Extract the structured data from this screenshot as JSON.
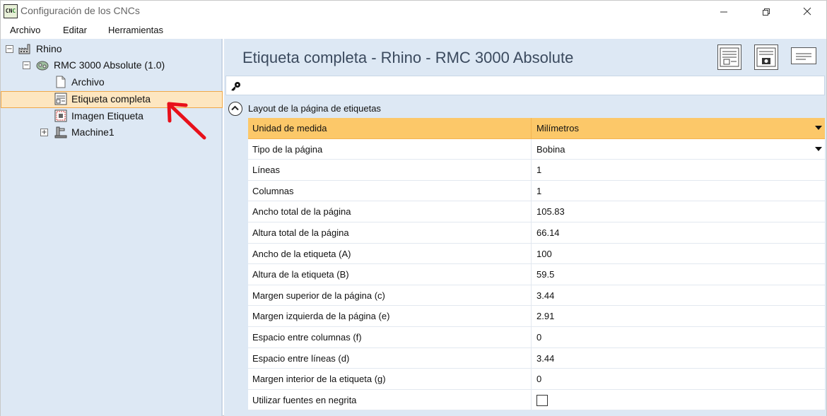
{
  "window": {
    "title": "Configuración de los CNCs",
    "icon_text_a": "CN",
    "icon_text_b": "C"
  },
  "menu": [
    "Archivo",
    "Editar",
    "Herramientas"
  ],
  "tree": {
    "root": "Rhino",
    "machine": "RMC 3000 Absolute (1.0)",
    "children": [
      "Archivo",
      "Etiqueta completa",
      "Imagen Etiqueta"
    ],
    "machine1": "Machine1",
    "expand_symbol": "−",
    "collapse_symbol": "+"
  },
  "panel": {
    "title": "Etiqueta completa - Rhino - RMC 3000 Absolute"
  },
  "group": {
    "label": "Layout de la página de etiquetas"
  },
  "properties": [
    {
      "name": "Unidad de medida",
      "value": "Milímetros",
      "dropdown": true,
      "selected": true
    },
    {
      "name": "Tipo de la página",
      "value": "Bobina",
      "dropdown": true
    },
    {
      "name": "Líneas",
      "value": "1"
    },
    {
      "name": "Columnas",
      "value": "1"
    },
    {
      "name": "Ancho total de la página",
      "value": "105.83"
    },
    {
      "name": "Altura total de la página",
      "value": "66.14"
    },
    {
      "name": "Ancho de la etiqueta (A)",
      "value": "100"
    },
    {
      "name": "Altura de la etiqueta (B)",
      "value": "59.5"
    },
    {
      "name": "Margen superior de la página (c)",
      "value": "3.44"
    },
    {
      "name": "Margen izquierda de la página (e)",
      "value": "2.91"
    },
    {
      "name": "Espacio entre columnas (f)",
      "value": "0"
    },
    {
      "name": "Espacio entre líneas (d)",
      "value": "3.44"
    },
    {
      "name": "Margen interior de la etiqueta (g)",
      "value": "0"
    },
    {
      "name": "Utilizar fuentes en negrita",
      "value": "",
      "checkbox": true,
      "checked": false
    }
  ],
  "colors": {
    "panel_bg": "#dde8f4",
    "selection_bg": "#fde6c0",
    "selected_row": "#fcc869",
    "annotation": "#e8101a"
  }
}
